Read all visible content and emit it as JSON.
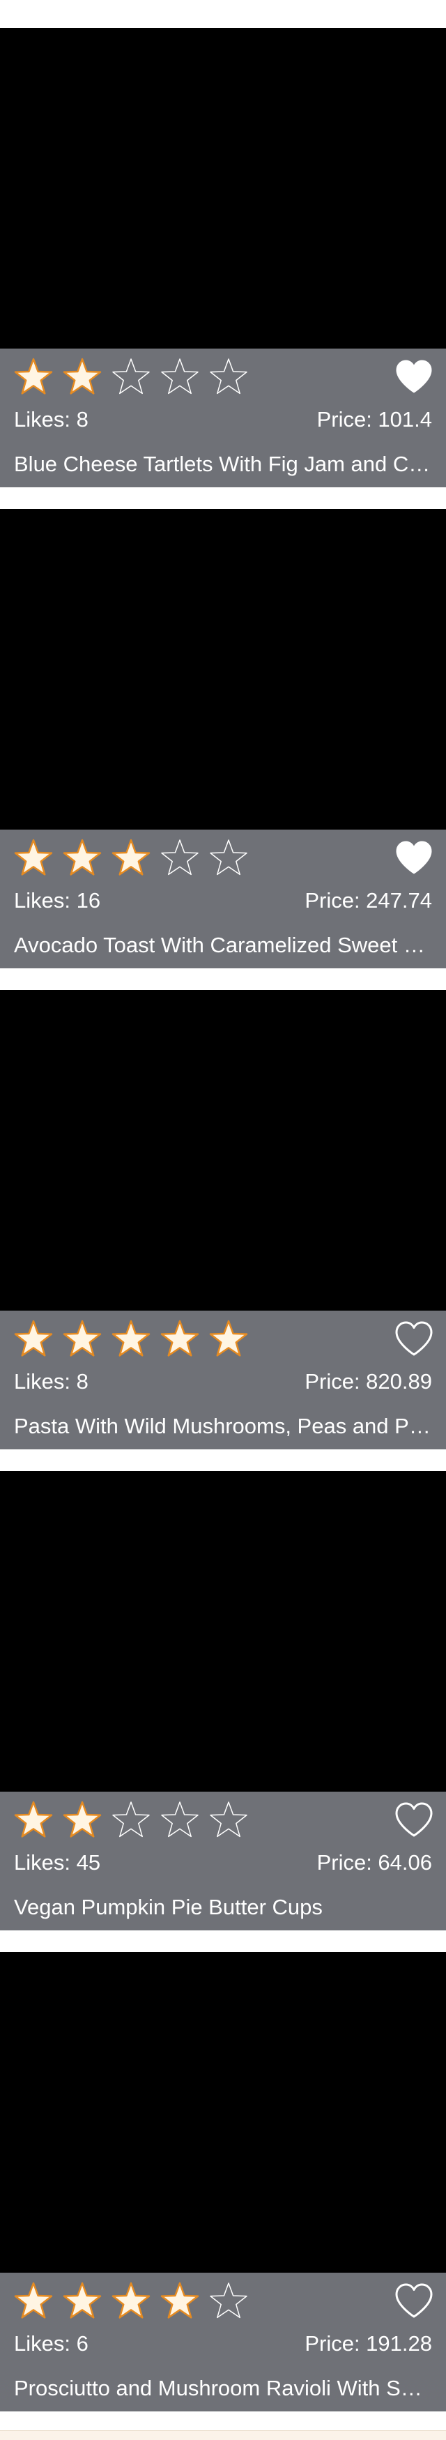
{
  "colors": {
    "card_info_bg": "#6f7177",
    "image_placeholder": "#000000",
    "star_filled": "#fff5e3",
    "star_filled_outline": "#e58b22",
    "star_empty_outline": "#ffffff",
    "heart": "#ffffff",
    "text": "#ffffff"
  },
  "icons": {
    "rating_star": "star-icon",
    "favorite": "heart-icon"
  },
  "rating_max": 5,
  "cards": [
    {
      "rating": 2,
      "liked": true,
      "likes_text": "Likes: 8",
      "price_text": "Price: 101.4",
      "title": "Blue Cheese Tartlets With Fig Jam and Caramelized Onions"
    },
    {
      "rating": 3,
      "liked": true,
      "likes_text": "Likes: 16",
      "price_text": "Price: 247.74",
      "title": "Avocado Toast With Caramelized Sweet Potatoes"
    },
    {
      "rating": 5,
      "liked": false,
      "likes_text": "Likes: 8",
      "price_text": "Price: 820.89",
      "title": "Pasta With Wild Mushrooms, Peas and Parmesan"
    },
    {
      "rating": 2,
      "liked": false,
      "likes_text": "Likes: 45",
      "price_text": "Price: 64.06",
      "title": "Vegan Pumpkin Pie Butter Cups"
    },
    {
      "rating": 4,
      "liked": false,
      "likes_text": "Likes: 6",
      "price_text": "Price: 191.28",
      "title": "Prosciutto and Mushroom Ravioli With Sage Butter"
    }
  ]
}
